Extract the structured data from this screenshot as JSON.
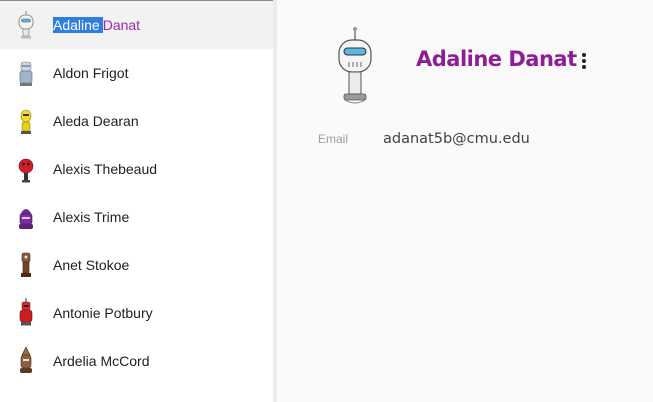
{
  "contacts": [
    {
      "first": "Adaline",
      "last": "Danat",
      "robot": "white",
      "active": true
    },
    {
      "name": "Aldon Frigot",
      "robot": "gray"
    },
    {
      "name": "Aleda Dearan",
      "robot": "yellow"
    },
    {
      "name": "Alexis Thebeaud",
      "robot": "red-round"
    },
    {
      "name": "Alexis Trime",
      "robot": "purple"
    },
    {
      "name": "Anet Stokoe",
      "robot": "brown"
    },
    {
      "name": "Antonie Potbury",
      "robot": "red-tall"
    },
    {
      "name": "Ardelia McCord",
      "robot": "brown-pointy"
    }
  ],
  "detail": {
    "name": "Adaline Danat",
    "email_label": "Email",
    "email_value": "adanat5b@cmu.edu",
    "avatar_icon": "robot-avatar-icon",
    "menu_icon": "more-vert-icon"
  },
  "colors": {
    "accent": "#9c27b0",
    "selection": "#2f7de1",
    "detail_name": "#8e1e96"
  }
}
